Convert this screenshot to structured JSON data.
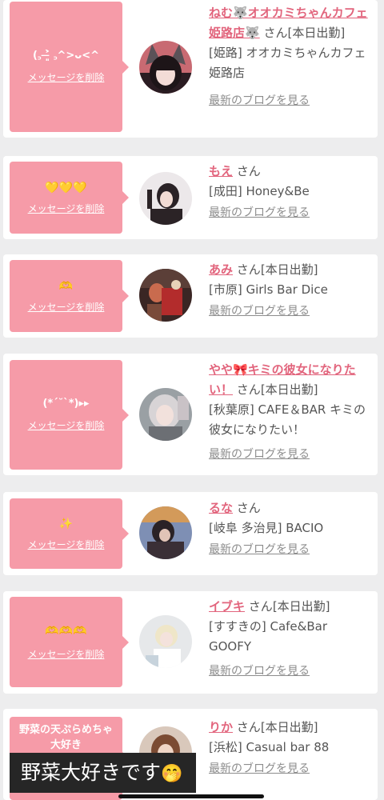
{
  "ui": {
    "delete_label": "メッセージを削除",
    "blog_label": "最新のブログを見る",
    "san_label": "さん"
  },
  "entries": [
    {
      "message": "(꜆ ˃̶͈̀ ꜆^>ᴗ<^",
      "name": "ねむ🐺オオカミちゃんカフェ姫路店🐺",
      "status": "[本日出勤]",
      "shop": "[姫路] オオカミちゃんカフェ姫路店"
    },
    {
      "message": "💛💛💛",
      "name": "もえ",
      "status": "",
      "shop": "[成田] Honey&Be"
    },
    {
      "message": "🫶",
      "name": "あみ",
      "status": "[本日出勤]",
      "shop": "[市原] Girls Bar Dice"
    },
    {
      "message": "(*ˊ˘ˋ*)▸▸",
      "name": "やや🎀キミの彼女になりたい！",
      "status": "[本日出勤]",
      "shop": "[秋葉原] CAFE＆BAR キミの彼女になりたい！"
    },
    {
      "message": "✨",
      "name": "るな",
      "status": "",
      "shop": "[岐阜 多治見] BACIO"
    },
    {
      "message": "🫶🫶🫶",
      "name": "イブキ",
      "status": "[本日出勤]",
      "shop": "[すすきの] Cafe&Bar GOOFY"
    },
    {
      "message": "野菜の天ぷらめちゃ大好き",
      "name": "りか",
      "status": "[本日出勤]",
      "shop": "[浜松] Casual bar 88"
    }
  ],
  "overlay": {
    "text": "野菜大好きです",
    "emoji": "🤭"
  },
  "colors": {
    "accent_pink": "#f69ba8",
    "name_pink": "#e2657d",
    "background": "#ededee"
  }
}
